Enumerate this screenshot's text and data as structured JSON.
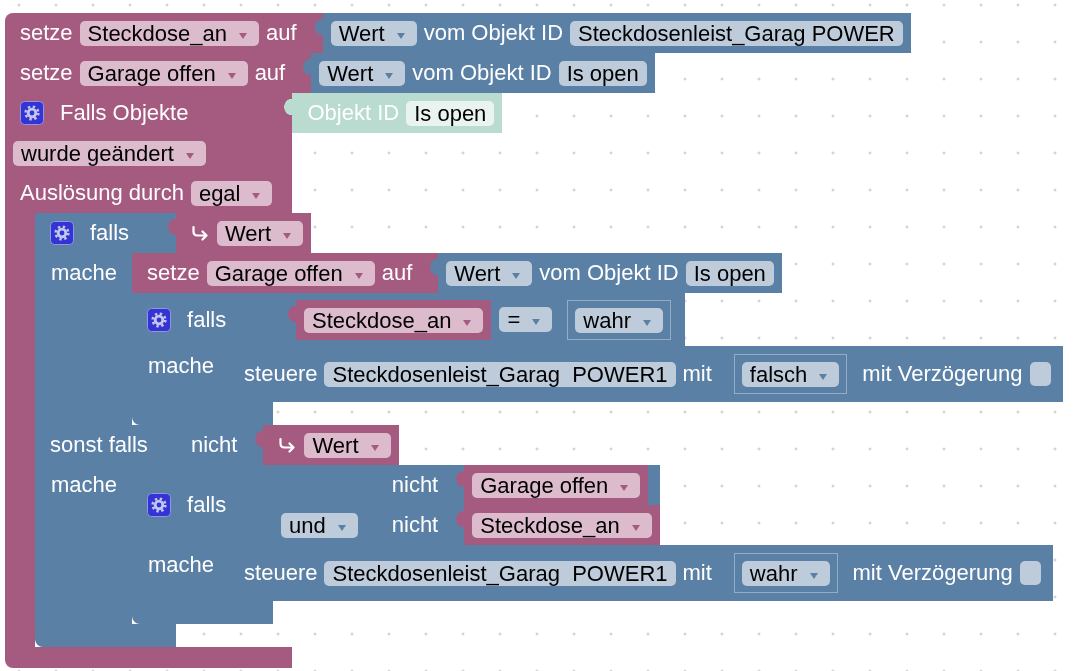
{
  "workspace": {
    "blocks": [
      {
        "kind": "set_variable",
        "label": "setze",
        "variable": "Steckdose_an",
        "connector": "auf",
        "value": {
          "kind": "get_state",
          "attribute": "Wert",
          "label": "vom Objekt ID",
          "object": "Steckdosenleist_Garag POWER"
        }
      },
      {
        "kind": "set_variable",
        "label": "setze",
        "variable": "Garage offen",
        "connector": "auf",
        "value": {
          "kind": "get_state",
          "attribute": "Wert",
          "label": "vom Objekt ID",
          "object": "Is open"
        }
      },
      {
        "kind": "on_change",
        "title": "Falls Objekte",
        "object": {
          "kind": "object_id",
          "label": "Objekt ID",
          "object": "Is open"
        },
        "event": "wurde geändert",
        "trigger_label": "Auslösung durch",
        "trigger": "egal",
        "statements": [
          {
            "kind": "if",
            "branches": [
              {
                "label": "falls",
                "condition": {
                  "kind": "trigger_value",
                  "field": "Wert"
                },
                "do_label": "mache",
                "statements": [
                  {
                    "kind": "set_variable",
                    "label": "setze",
                    "variable": "Garage offen",
                    "connector": "auf",
                    "value": {
                      "kind": "get_state",
                      "attribute": "Wert",
                      "label": "vom Objekt ID",
                      "object": "Is open"
                    }
                  },
                  {
                    "kind": "if",
                    "branches": [
                      {
                        "label": "falls",
                        "condition": {
                          "kind": "compare",
                          "left": {
                            "kind": "variable",
                            "name": "Steckdose_an"
                          },
                          "operator": "=",
                          "right": {
                            "kind": "boolean",
                            "value": "wahr"
                          }
                        },
                        "do_label": "mache",
                        "statements": [
                          {
                            "kind": "control",
                            "label": "steuere",
                            "object": "Steckdosenleist_Garag  POWER1",
                            "with_label": "mit",
                            "value": {
                              "kind": "boolean",
                              "value": "falsch"
                            },
                            "delay_label": "mit Verzögerung",
                            "delay": false
                          }
                        ]
                      }
                    ]
                  }
                ]
              },
              {
                "label": "sonst falls",
                "condition": {
                  "kind": "not",
                  "label": "nicht",
                  "operand": {
                    "kind": "trigger_value",
                    "field": "Wert"
                  }
                },
                "do_label": "mache",
                "statements": [
                  {
                    "kind": "if",
                    "branches": [
                      {
                        "label": "falls",
                        "condition": {
                          "kind": "logic",
                          "operator": "und",
                          "operands": [
                            {
                              "kind": "not",
                              "label": "nicht",
                              "operand": {
                                "kind": "variable",
                                "name": "Garage offen"
                              }
                            },
                            {
                              "kind": "not",
                              "label": "nicht",
                              "operand": {
                                "kind": "variable",
                                "name": "Steckdose_an"
                              }
                            }
                          ]
                        },
                        "do_label": "mache",
                        "statements": [
                          {
                            "kind": "control",
                            "label": "steuere",
                            "object": "Steckdosenleist_Garag  POWER1",
                            "with_label": "mit",
                            "value": {
                              "kind": "boolean",
                              "value": "wahr"
                            },
                            "delay_label": "mit Verzögerung",
                            "delay": false
                          }
                        ]
                      }
                    ]
                  }
                ]
              }
            ]
          }
        ]
      }
    ]
  }
}
